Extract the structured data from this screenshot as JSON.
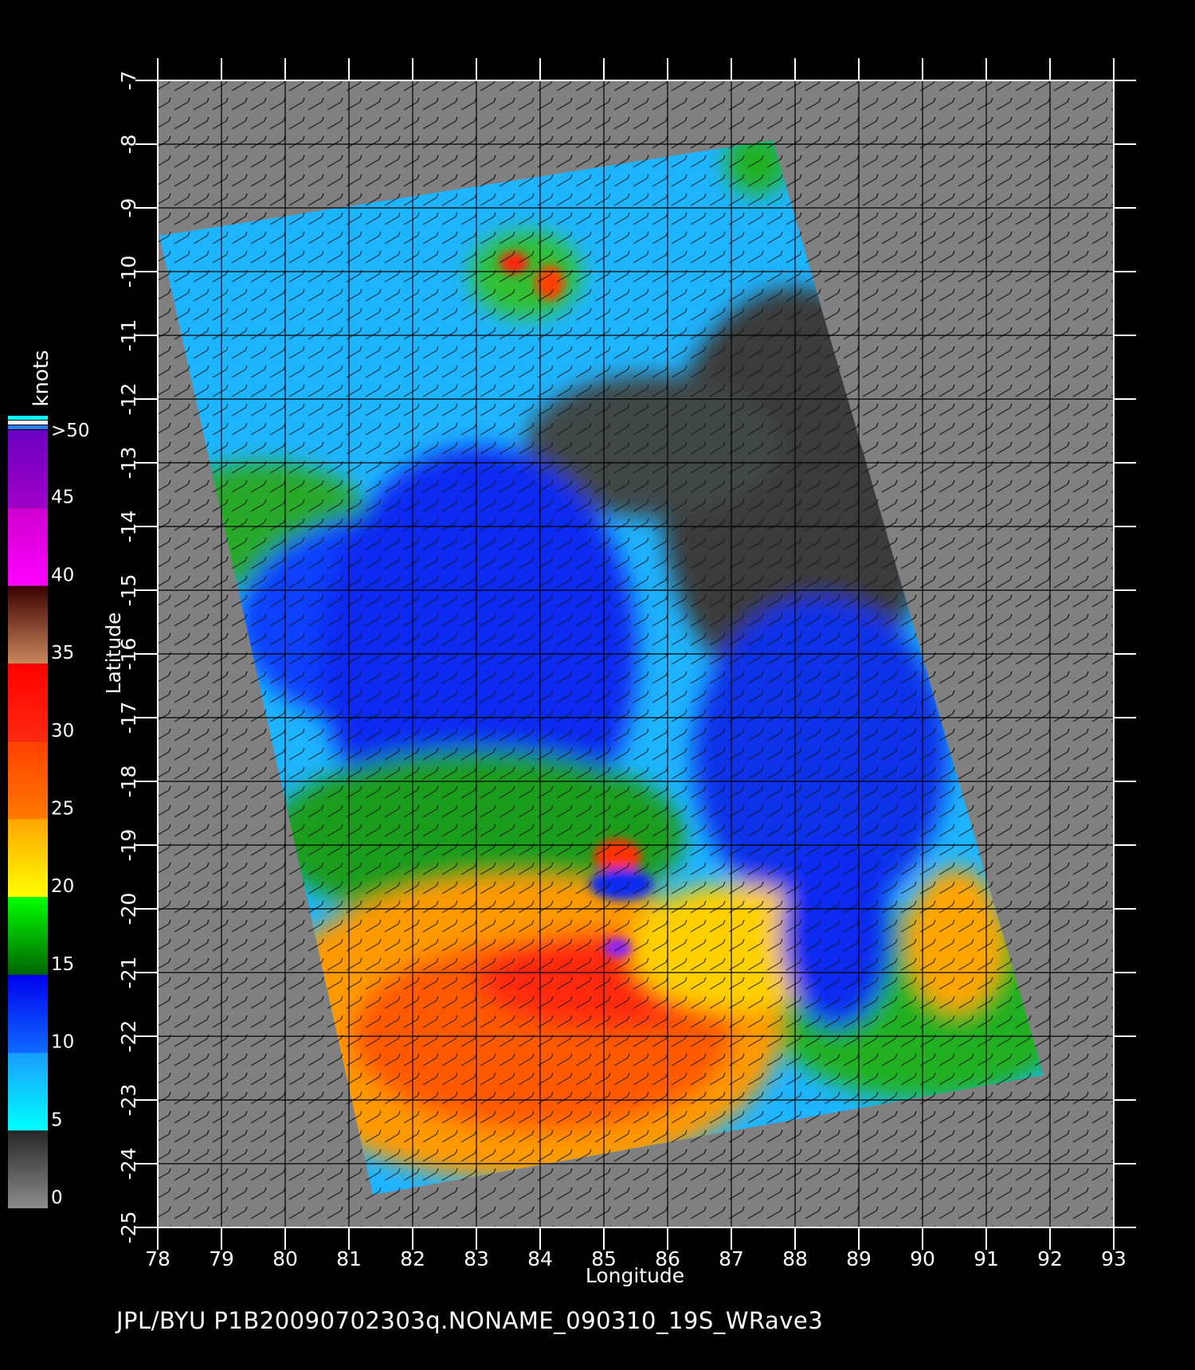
{
  "map": {
    "xlabel": "Longitude",
    "ylabel": "Latitude",
    "lon_range": [
      78,
      93
    ],
    "lat_range": [
      -25,
      -7
    ],
    "lon_ticks": [
      "78",
      "79",
      "80",
      "81",
      "82",
      "83",
      "84",
      "85",
      "86",
      "87",
      "88",
      "89",
      "90",
      "91",
      "92",
      "93"
    ],
    "lat_ticks": [
      "-7",
      "-8",
      "-9",
      "-10",
      "-11",
      "-12",
      "-13",
      "-14",
      "-15",
      "-16",
      "-17",
      "-18",
      "-19",
      "-20",
      "-21",
      "-22",
      "-23",
      "-24",
      "-25"
    ],
    "background_color": "#000000",
    "no_data_color": "#808080",
    "grid_color": "#000000"
  },
  "colorbar": {
    "title": "knots",
    "labels": [
      ">50",
      "45",
      "40",
      "35",
      "30",
      "25",
      "20",
      "15",
      "10",
      "5",
      "0"
    ],
    "segments": [
      {
        "from": 0,
        "to": 5,
        "colors": [
          "#8c8c8c",
          "#262626"
        ]
      },
      {
        "from": 5,
        "to": 10,
        "colors": [
          "#00ffff",
          "#1a9cff"
        ]
      },
      {
        "from": 10,
        "to": 15,
        "colors": [
          "#0f6aff",
          "#0000ee"
        ]
      },
      {
        "from": 15,
        "to": 20,
        "colors": [
          "#006400",
          "#00ff00"
        ]
      },
      {
        "from": 20,
        "to": 25,
        "colors": [
          "#ffff00",
          "#ffa500"
        ]
      },
      {
        "from": 25,
        "to": 30,
        "colors": [
          "#ff7a00",
          "#ff4000"
        ]
      },
      {
        "from": 30,
        "to": 35,
        "colors": [
          "#ff2a10",
          "#ff0000"
        ]
      },
      {
        "from": 35,
        "to": 40,
        "colors": [
          "#c9875a",
          "#3a0000"
        ]
      },
      {
        "from": 40,
        "to": 45,
        "colors": [
          "#ff00ff",
          "#cc00cc"
        ]
      },
      {
        "from": 45,
        "to": 50,
        "colors": [
          "#a000c8",
          "#6a00c0"
        ]
      }
    ],
    "top_strip_colors": [
      "#00ffff",
      "#ffffff",
      "#2d7cff"
    ]
  },
  "caption": "JPL/BYU  P1B20090702303q.NONAME_090310_19S_WRave3"
}
